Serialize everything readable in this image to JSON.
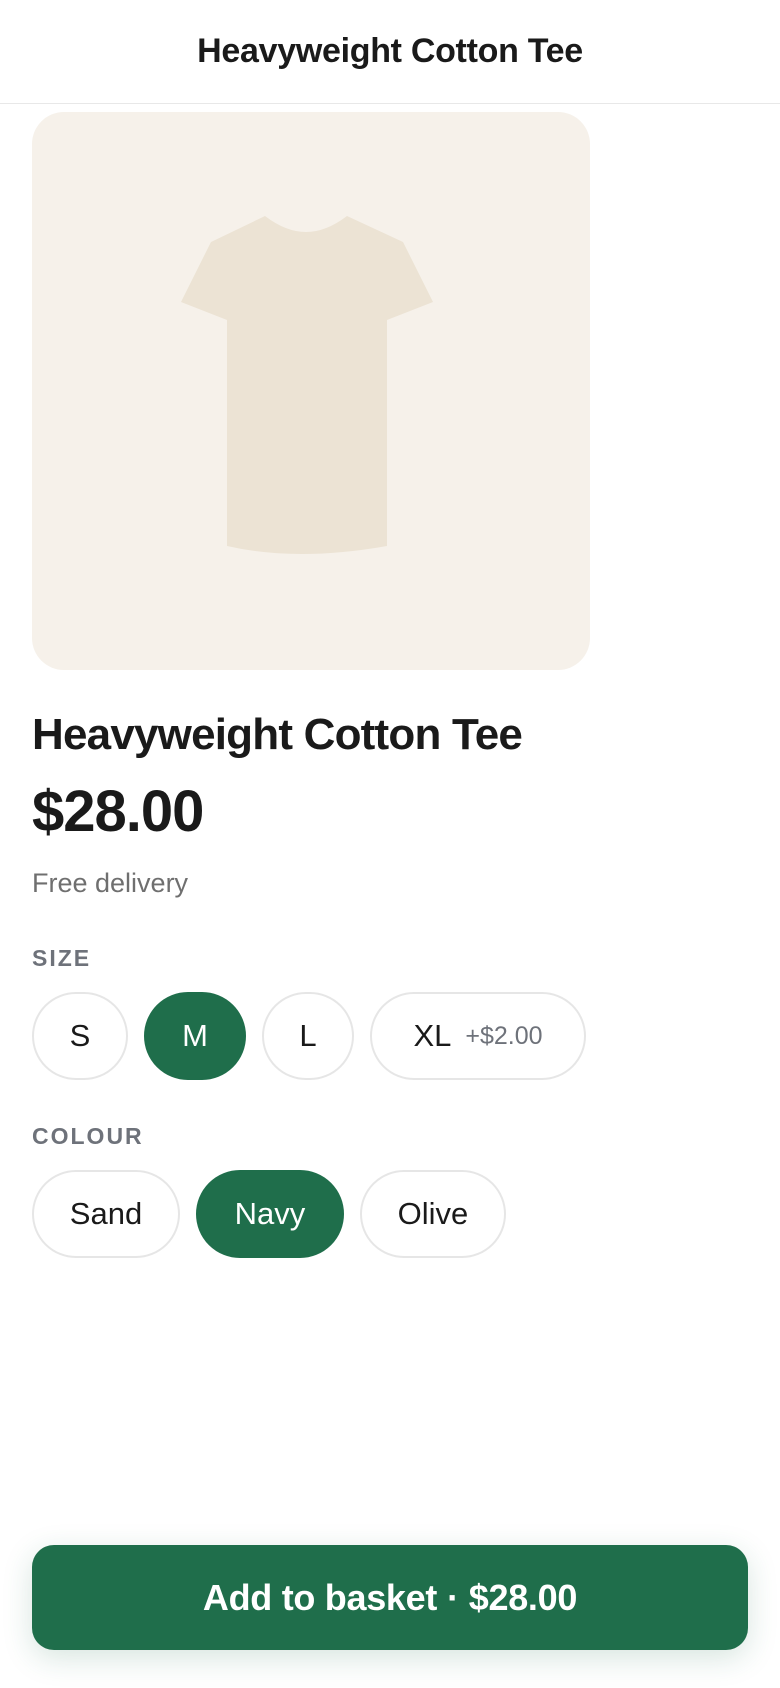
{
  "header": {
    "title": "Heavyweight Cotton Tee"
  },
  "product": {
    "image_icon": "tshirt-image",
    "title": "Heavyweight Cotton Tee",
    "price": "$28.00",
    "delivery": "Free delivery"
  },
  "size": {
    "label": "SIZE",
    "options": [
      {
        "label": "S",
        "extra": "",
        "selected": false
      },
      {
        "label": "M",
        "extra": "",
        "selected": true
      },
      {
        "label": "L",
        "extra": "",
        "selected": false
      },
      {
        "label": "XL",
        "extra": "+$2.00",
        "selected": false
      }
    ]
  },
  "colour": {
    "label": "COLOUR",
    "options": [
      {
        "label": "Sand",
        "selected": false
      },
      {
        "label": "Navy",
        "selected": true
      },
      {
        "label": "Olive",
        "selected": false
      }
    ]
  },
  "cta": {
    "label": "Add to basket",
    "separator": "·",
    "price": "$28.00"
  },
  "colors": {
    "accent": "#1f6e4b",
    "image_bg": "#f6f1ea",
    "shirt": "#ece3d4"
  }
}
